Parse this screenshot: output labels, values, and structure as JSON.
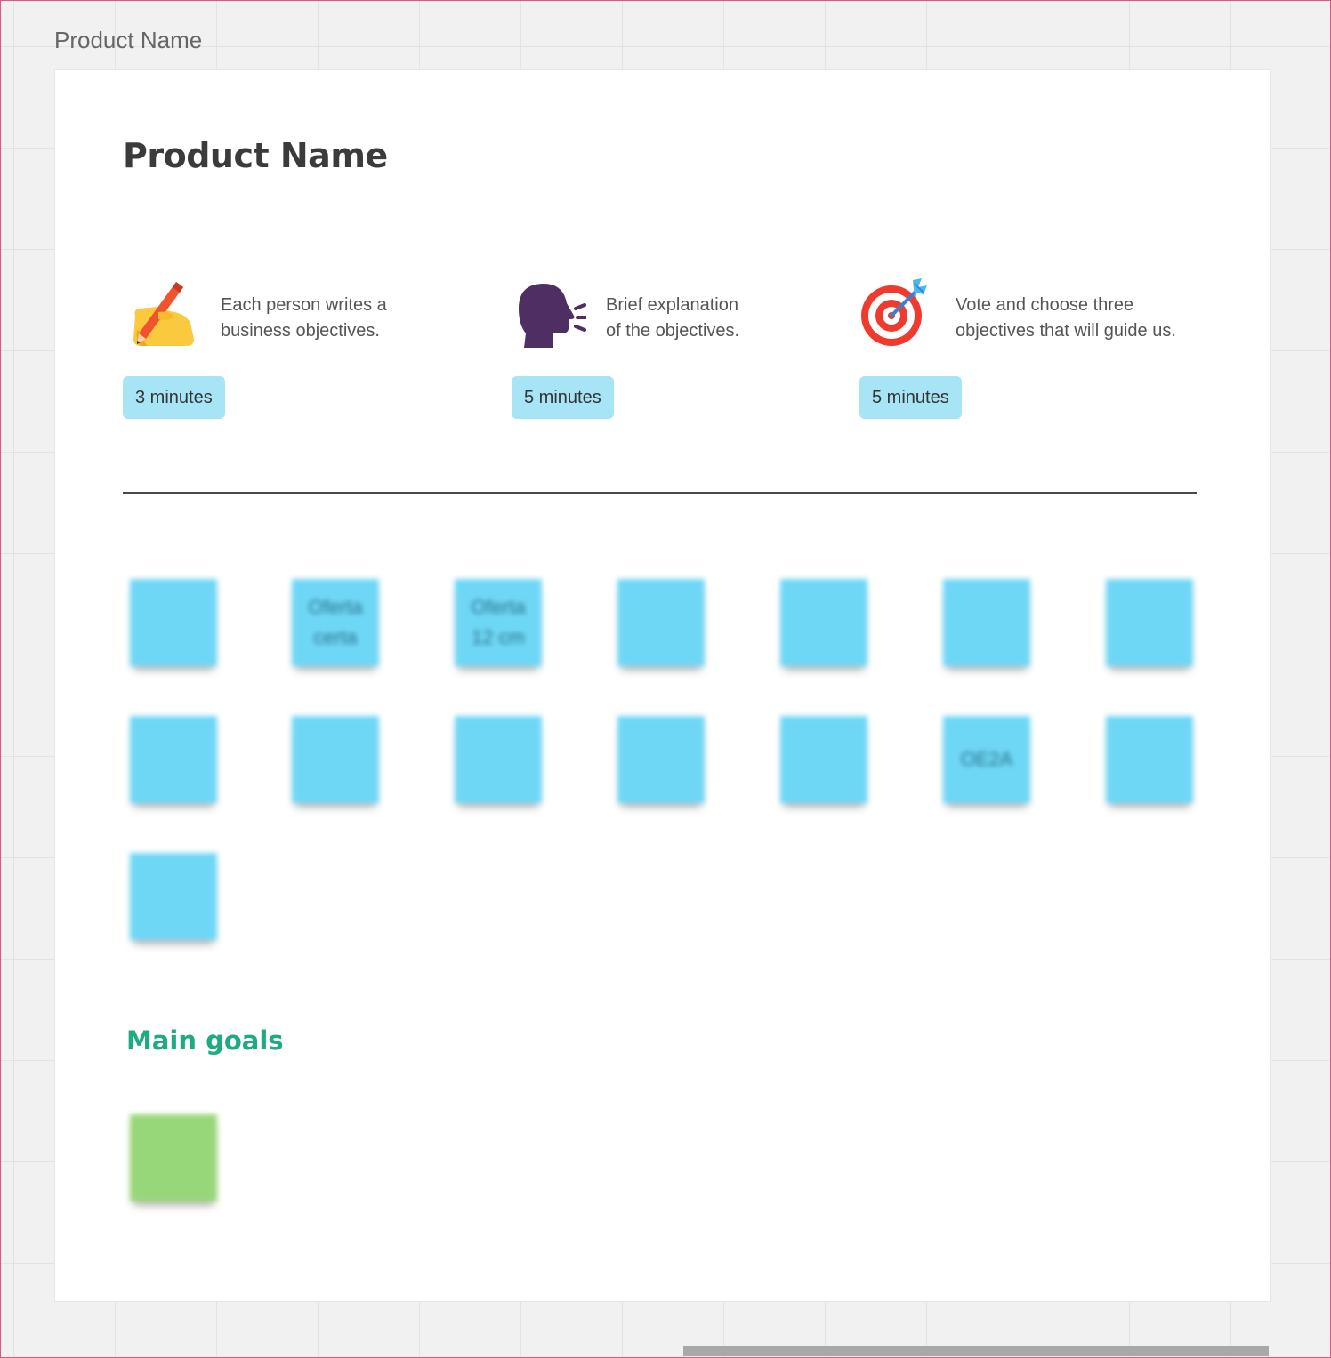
{
  "board": {
    "frame_label": "Product Name",
    "title": "Product Name"
  },
  "steps": [
    {
      "text": "Each person writes a\nbusiness objectives.",
      "duration": "3 minutes",
      "icon": "writing-hand-icon"
    },
    {
      "text": "Brief explanation\nof the objectives.",
      "duration": "5 minutes",
      "icon": "speaking-head-icon"
    },
    {
      "text": "Vote and choose three\nobjectives that will guide us.",
      "duration": "5 minutes",
      "icon": "target-dart-icon"
    }
  ],
  "stickies": {
    "row1": [
      "",
      "Oferta\ncerta",
      "Oferta\n12 cm",
      "",
      "",
      "",
      ""
    ],
    "row2": [
      "",
      "",
      "",
      "",
      "",
      "OE2A",
      ""
    ],
    "row3": [
      ""
    ]
  },
  "main_goals": {
    "heading": "Main goals",
    "stickies": [
      ""
    ]
  },
  "colors": {
    "sticky_blue": "#6fd7f6",
    "sticky_green": "#98d779",
    "pill": "#a6e4f6",
    "heading_green": "#1eaa82",
    "canvas_border": "#e05585"
  }
}
